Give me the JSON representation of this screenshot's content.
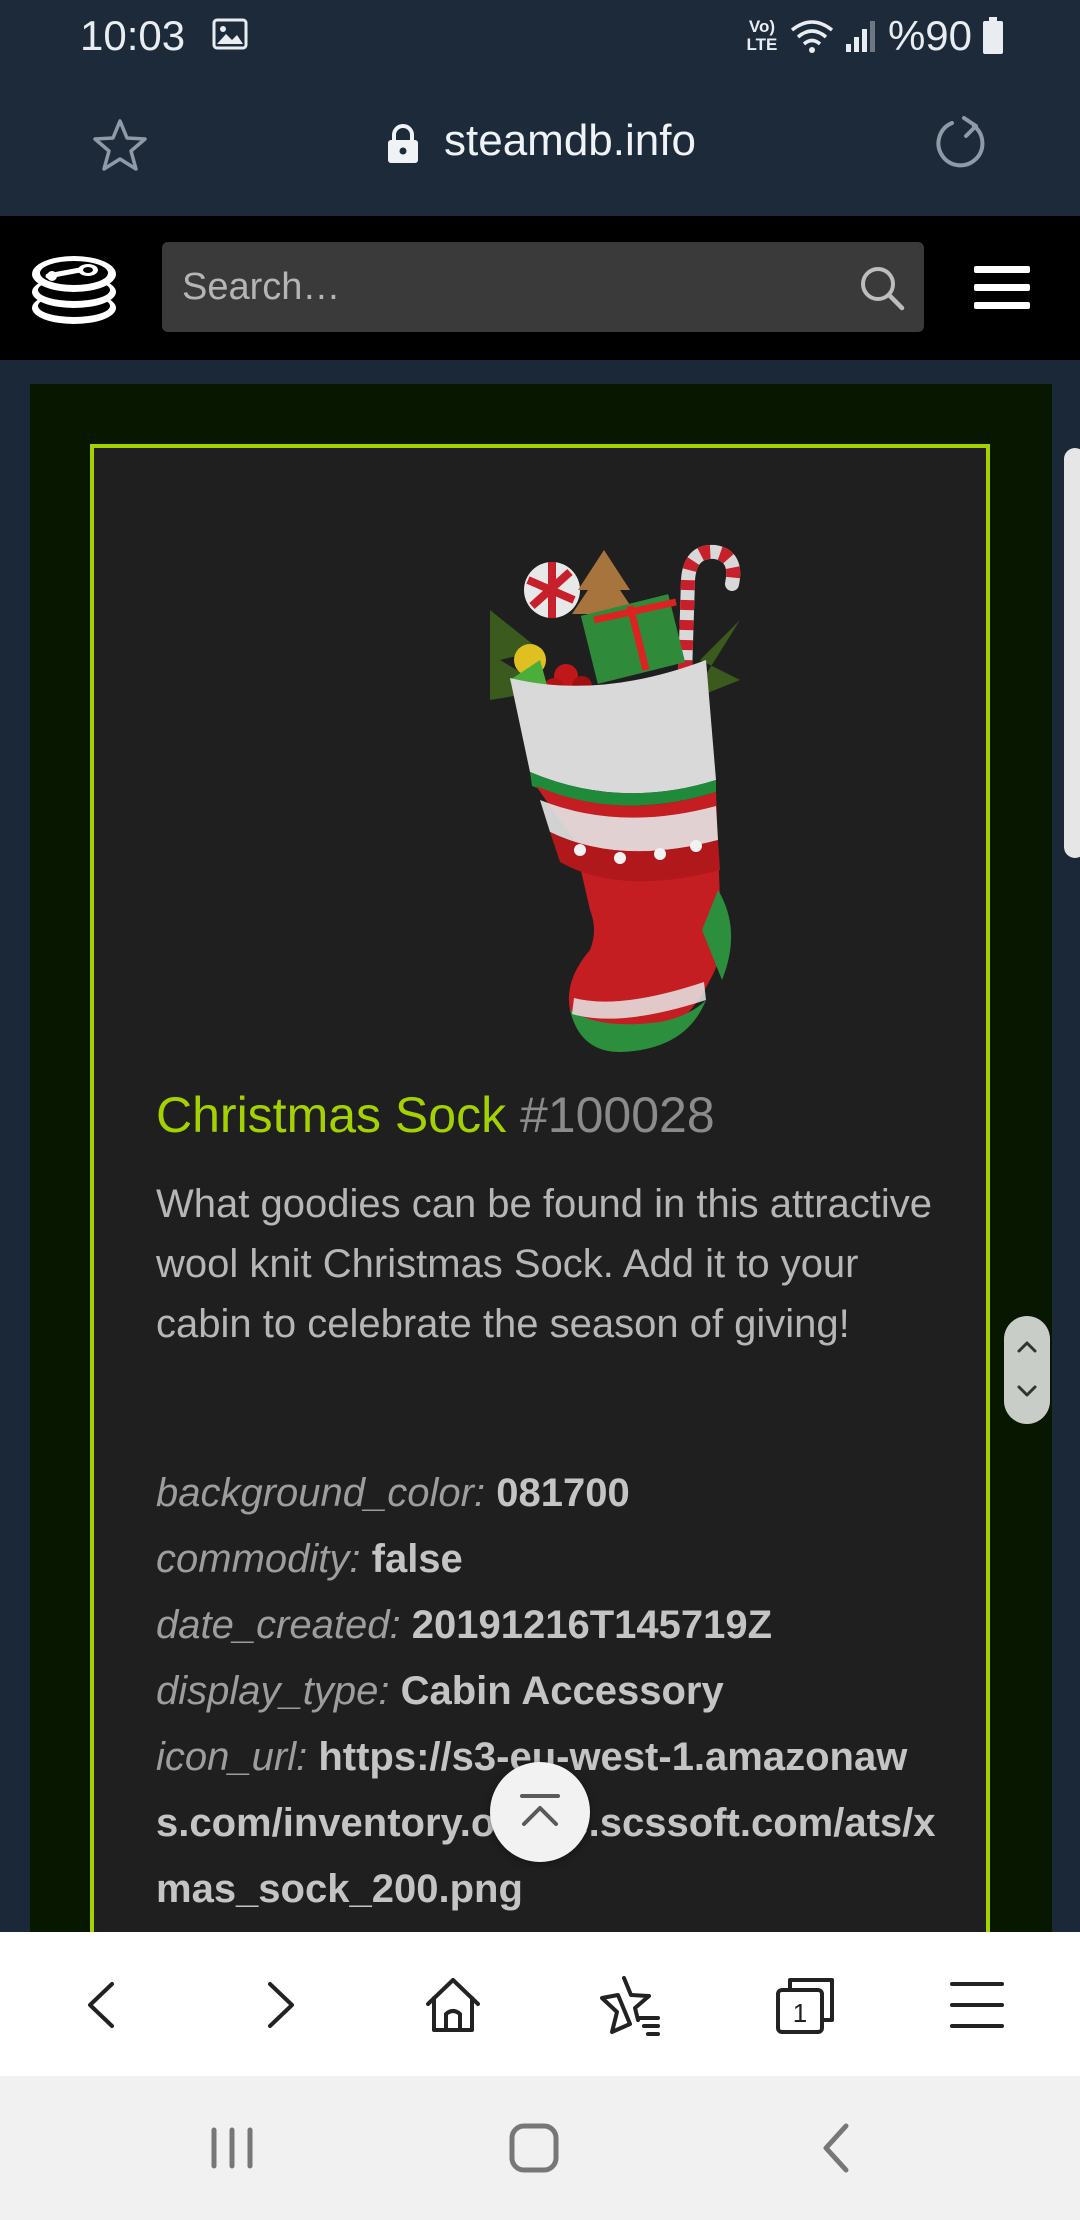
{
  "status_bar": {
    "time": "10:03",
    "network_label": "Vo) LTE",
    "battery_text": "%90",
    "icons": [
      "gallery-icon",
      "wifi-icon",
      "signal-icon",
      "battery-icon"
    ]
  },
  "browser": {
    "url": "steamdb.info",
    "icons": [
      "star-icon",
      "lock-icon",
      "reload-icon"
    ]
  },
  "site_header": {
    "search_placeholder": "Search…",
    "icons": [
      "steamdb-logo",
      "search-icon",
      "hamburger-icon"
    ]
  },
  "item": {
    "name": "Christmas Sock",
    "id": "#100028",
    "description": "What goodies can be found in this attractive wool knit Christmas Sock. Add it to your cabin to celebrate the season of giving!",
    "properties": [
      {
        "key": "background_color:",
        "value": "081700"
      },
      {
        "key": "commodity:",
        "value": "false"
      },
      {
        "key": "date_created:",
        "value": "20191216T145719Z"
      },
      {
        "key": "display_type:",
        "value": "Cabin Accessory"
      },
      {
        "key": "icon_url:",
        "value": "https://s3-eu-west-1.amazonaws.com/inventory.online.scssoft.com/ats/xmas_sock_200.png"
      }
    ],
    "colors": {
      "accent": "#a3d200",
      "background": "#081700",
      "card": "#1f1f1f"
    }
  },
  "bottom_toolbar": {
    "icons": [
      "back-icon",
      "forward-icon",
      "home-icon",
      "bookmarks-icon",
      "tabs-icon",
      "menu-icon"
    ],
    "tabs_count": "1"
  },
  "nav_bar": {
    "icons": [
      "recents-icon",
      "home-icon",
      "back-icon"
    ]
  }
}
